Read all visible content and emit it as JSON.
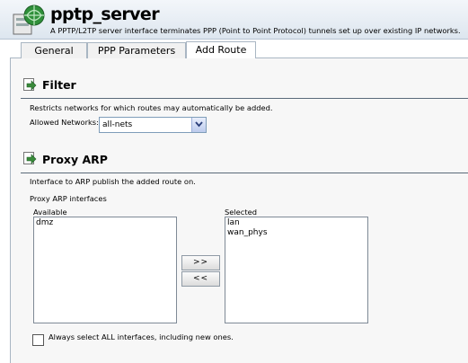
{
  "header": {
    "title": "pptp_server",
    "subtitle": "A PPTP/L2TP server interface terminates PPP (Point to Point Protocol) tunnels set up over existing IP networks.",
    "icon": "interface-icon"
  },
  "tabs": [
    {
      "label": "General",
      "active": false
    },
    {
      "label": "PPP Parameters",
      "active": false
    },
    {
      "label": "Add Route",
      "active": true
    }
  ],
  "filter": {
    "title": "Filter",
    "description": "Restricts networks for which routes may automatically be added.",
    "allowed_networks_label": "Allowed Networks:",
    "allowed_networks_value": "all-nets"
  },
  "proxy_arp": {
    "title": "Proxy ARP",
    "description": "Interface to ARP publish the added route on.",
    "interfaces_label": "Proxy ARP interfaces",
    "available_label": "Available",
    "available_items": [
      "dmz"
    ],
    "selected_label": "Selected",
    "selected_items": [
      "lan",
      "wan_phys"
    ],
    "add_button": ">>",
    "remove_button": "<<",
    "always_select_all_label": "Always select ALL interfaces, including new ones.",
    "always_select_all_checked": false
  },
  "colors": {
    "header_bg": "#dde6ef",
    "content_bg": "#f7f7f7",
    "section_icon": "#3a8a3a"
  }
}
